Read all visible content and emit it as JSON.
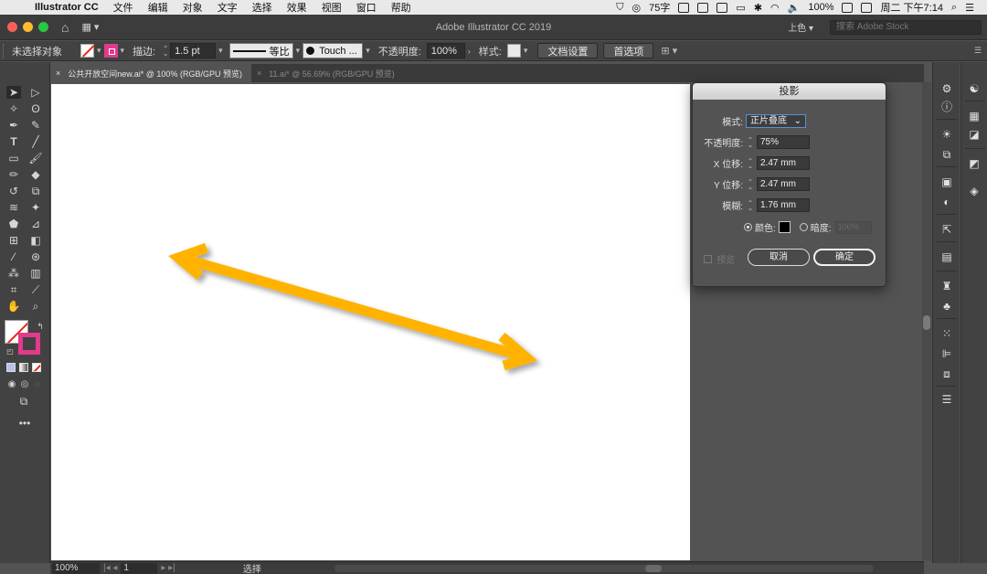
{
  "menubar": {
    "app_name": "Illustrator CC",
    "items": [
      "文件",
      "编辑",
      "对象",
      "文字",
      "选择",
      "效果",
      "视图",
      "窗口",
      "帮助"
    ],
    "status": {
      "percent_badge": "75字",
      "battery": "100%",
      "clock": "周二 下午7:14"
    }
  },
  "titlebar": {
    "title": "Adobe Illustrator CC 2019",
    "workspace": "上色",
    "stock_placeholder": "搜索 Adobe Stock"
  },
  "controlbar": {
    "selection": "未选择对象",
    "stroke_label": "描边:",
    "stroke_weight": "1.5 pt",
    "stroke_profile": "等比",
    "brush": "Touch ...",
    "opacity_label": "不透明度:",
    "opacity": "100%",
    "style_label": "样式:",
    "doc_setup": "文档设置",
    "preferences": "首选项"
  },
  "tabs": [
    {
      "label": "公共开放空间new.ai* @ 100% (RGB/GPU 预览)"
    },
    {
      "label": "11.ai* @ 56.69% (RGB/GPU 预览)"
    }
  ],
  "canvas": {
    "arrow_color": "#FFB300"
  },
  "statusbar": {
    "zoom": "100%",
    "page": "1",
    "status": "选择"
  },
  "dialog": {
    "title": "投影",
    "mode_label": "模式:",
    "mode": "正片叠底",
    "opacity_label": "不透明度:",
    "opacity": "75%",
    "x_label": "X 位移:",
    "x_offset": "2.47 mm",
    "y_label": "Y 位移:",
    "y_offset": "2.47 mm",
    "blur_label": "模糊:",
    "blur": "1.76 mm",
    "color_label": "颜色:",
    "darkness_label": "暗度:",
    "darkness": "100%",
    "preview_label": "预览",
    "cancel": "取消",
    "ok": "确定"
  }
}
